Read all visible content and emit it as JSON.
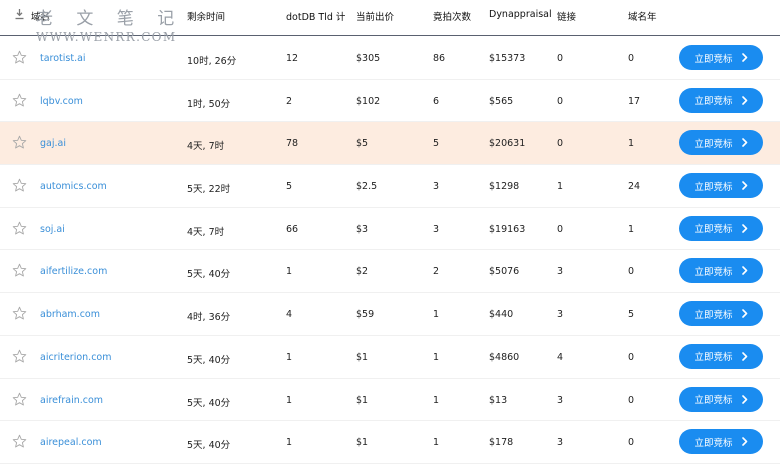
{
  "header": {
    "domain": "域名",
    "time_left": "剩余时间",
    "dotdb": "dotDB Tld 计",
    "current_bid": "当前出价",
    "bid_count": "竟拍次数",
    "dynappraisal": "Dynappraisal",
    "links": "链接",
    "age": "域名年"
  },
  "watermark": {
    "cn": "老 文 笔 记",
    "en": "WWW.WENRR.COM"
  },
  "bid_label": "立即竞标",
  "rows": [
    {
      "domain": "tarotist.ai",
      "time": "10时, 26分",
      "dotdb": "12",
      "price": "$305",
      "bids": "86",
      "appraisal": "$15373",
      "links": "0",
      "age": "0"
    },
    {
      "domain": "lqbv.com",
      "time": "1时, 50分",
      "dotdb": "2",
      "price": "$102",
      "bids": "6",
      "appraisal": "$565",
      "links": "0",
      "age": "17"
    },
    {
      "domain": "gaj.ai",
      "time": "4天, 7时",
      "dotdb": "78",
      "price": "$5",
      "bids": "5",
      "appraisal": "$20631",
      "links": "0",
      "age": "1"
    },
    {
      "domain": "automics.com",
      "time": "5天, 22时",
      "dotdb": "5",
      "price": "$2.5",
      "bids": "3",
      "appraisal": "$1298",
      "links": "1",
      "age": "24"
    },
    {
      "domain": "soj.ai",
      "time": "4天, 7时",
      "dotdb": "66",
      "price": "$3",
      "bids": "3",
      "appraisal": "$19163",
      "links": "0",
      "age": "1"
    },
    {
      "domain": "aifertilize.com",
      "time": "5天, 40分",
      "dotdb": "1",
      "price": "$2",
      "bids": "2",
      "appraisal": "$5076",
      "links": "3",
      "age": "0"
    },
    {
      "domain": "abrham.com",
      "time": "4时, 36分",
      "dotdb": "4",
      "price": "$59",
      "bids": "1",
      "appraisal": "$440",
      "links": "3",
      "age": "5"
    },
    {
      "domain": "aicriterion.com",
      "time": "5天, 40分",
      "dotdb": "1",
      "price": "$1",
      "bids": "1",
      "appraisal": "$4860",
      "links": "4",
      "age": "0"
    },
    {
      "domain": "airefrain.com",
      "time": "5天, 40分",
      "dotdb": "1",
      "price": "$1",
      "bids": "1",
      "appraisal": "$13",
      "links": "3",
      "age": "0"
    },
    {
      "domain": "airepeal.com",
      "time": "5天, 40分",
      "dotdb": "1",
      "price": "$1",
      "bids": "1",
      "appraisal": "$178",
      "links": "3",
      "age": "0"
    }
  ]
}
